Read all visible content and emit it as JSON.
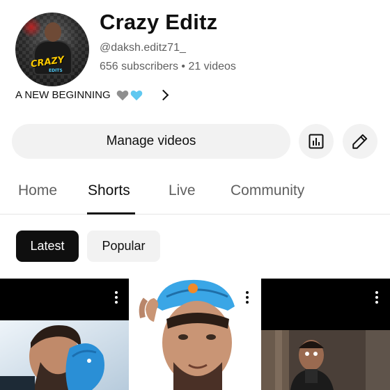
{
  "channel": {
    "name": "Crazy Editz",
    "handle": "@daksh.editz71_",
    "meta": "656 subscribers • 21 videos",
    "description": "A NEW BEGINNING",
    "avatar_logo": "CRAZY",
    "avatar_logo_sub": "EDITS"
  },
  "actions": {
    "manage_label": "Manage videos",
    "analytics_icon": "analytics-icon",
    "edit_icon": "pencil-icon"
  },
  "tabs": [
    {
      "label": "Home",
      "active": false
    },
    {
      "label": "Shorts",
      "active": true
    },
    {
      "label": "Live",
      "active": false
    },
    {
      "label": "Community",
      "active": false
    }
  ],
  "filters": {
    "latest": "Latest",
    "popular": "Popular",
    "selected": "Latest"
  },
  "colors": {
    "heart_grey": "#8f8f8f",
    "heart_blue": "#5fc8f0",
    "chip_active": "#0f0f0f",
    "chip_inactive": "#f2f2f2"
  }
}
